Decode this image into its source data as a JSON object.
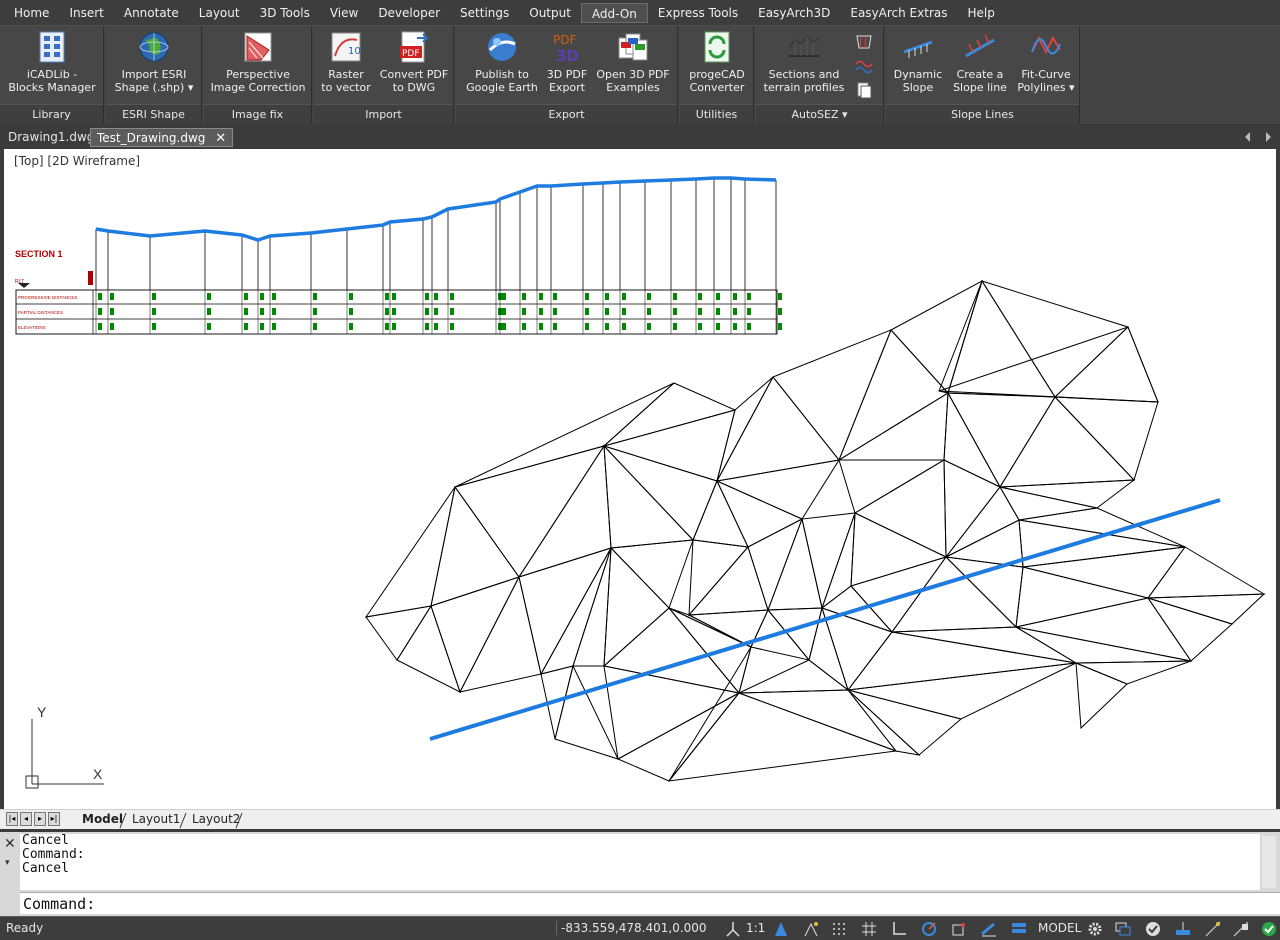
{
  "menu": {
    "tabs": [
      "Home",
      "Insert",
      "Annotate",
      "Layout",
      "3D Tools",
      "View",
      "Developer",
      "Settings",
      "Output",
      "Add-On",
      "Express Tools",
      "EasyArch3D",
      "EasyArch Extras",
      "Help"
    ],
    "active_tab": "Add-On"
  },
  "ribbon": {
    "library": {
      "title": "Library",
      "btn1": "iCADLib -",
      "btn2": "Blocks Manager"
    },
    "esri": {
      "title": "ESRI Shape",
      "btn1": "Import ESRI",
      "btn2": "Shape (.shp) ▾"
    },
    "imagefix": {
      "title": "Image fix",
      "btn1": "Perspective",
      "btn2": "Image Correction"
    },
    "import": {
      "title": "Import",
      "raster1": "Raster",
      "raster2": "to vector",
      "pdf1": "Convert PDF",
      "pdf2": "to DWG"
    },
    "export": {
      "title": "Export",
      "ge1": "Publish to",
      "ge2": "Google Earth",
      "pdf3d1": "3D PDF",
      "pdf3d2": "Export",
      "open1": "Open 3D PDF",
      "open2": "Examples"
    },
    "utilities": {
      "title": "Utilities",
      "btn1": "progeCAD",
      "btn2": "Converter"
    },
    "autosez": {
      "title": "AutoSEZ ▾",
      "btn1": "Sections and",
      "btn2": "terrain profiles"
    },
    "slopelines": {
      "title": "Slope Lines",
      "dyn1": "Dynamic",
      "dyn2": "Slope",
      "create1": "Create a",
      "create2": "Slope line",
      "fit1": "Fit-Curve",
      "fit2": "Polylines ▾"
    }
  },
  "documents": {
    "tab1": "Drawing1.dwg",
    "tab2": "Test_Drawing.dwg",
    "close": "✕"
  },
  "canvas": {
    "view_label": "[Top] [2D Wireframe]",
    "section_title": "SECTION 1",
    "section_marker": "RLT",
    "row1": "PROGRESSIVE DISTANCES",
    "row2": "PARTIAL DISTANCES",
    "row3": "ELEVATIONS",
    "ucs_x": "X",
    "ucs_y": "Y"
  },
  "layouts": {
    "tabs": [
      "Model",
      "Layout1",
      "Layout2"
    ],
    "active": "Model"
  },
  "command": {
    "history": [
      "Cancel",
      "Command:",
      "Cancel"
    ],
    "prompt": "Command:"
  },
  "status": {
    "ready": "Ready",
    "coords": "-833.559,478.401,0.000",
    "scale": "1:1",
    "model": "MODEL"
  },
  "colors": {
    "profile_line": "#1e7be0",
    "section_red": "#b00000",
    "table_green": "#008a00"
  }
}
